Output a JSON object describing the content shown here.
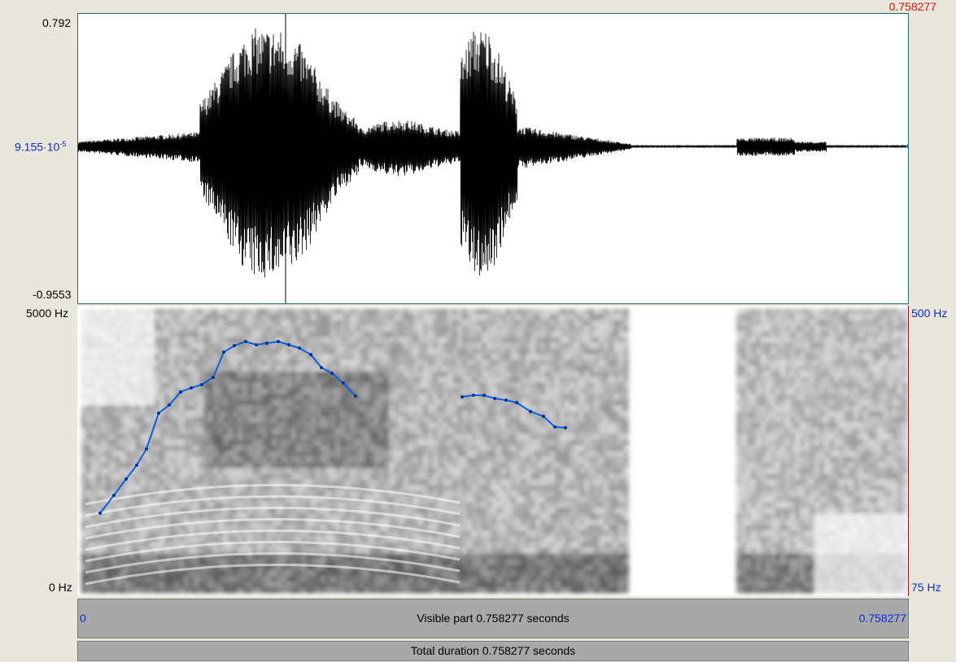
{
  "waveform": {
    "top_value": "0.792",
    "middle_value": "9.155·10",
    "middle_exponent": "-5",
    "bottom_value": "-0.9553",
    "cursor_time": "0.758277"
  },
  "spectrogram": {
    "freq_top_left": "5000 Hz",
    "freq_bottom_left": "0 Hz",
    "pitch_top_right": "500 Hz",
    "pitch_bottom_right": "75 Hz"
  },
  "visible_bar": {
    "start": "0",
    "label": "Visible part 0.758277 seconds",
    "end": "0.758277"
  },
  "total_bar": {
    "label": "Total duration 0.758277 seconds"
  },
  "colors": {
    "pitch": "#0a5fe0",
    "cursor_label": "#e01010",
    "axis_label": "#0a2bd6"
  }
}
